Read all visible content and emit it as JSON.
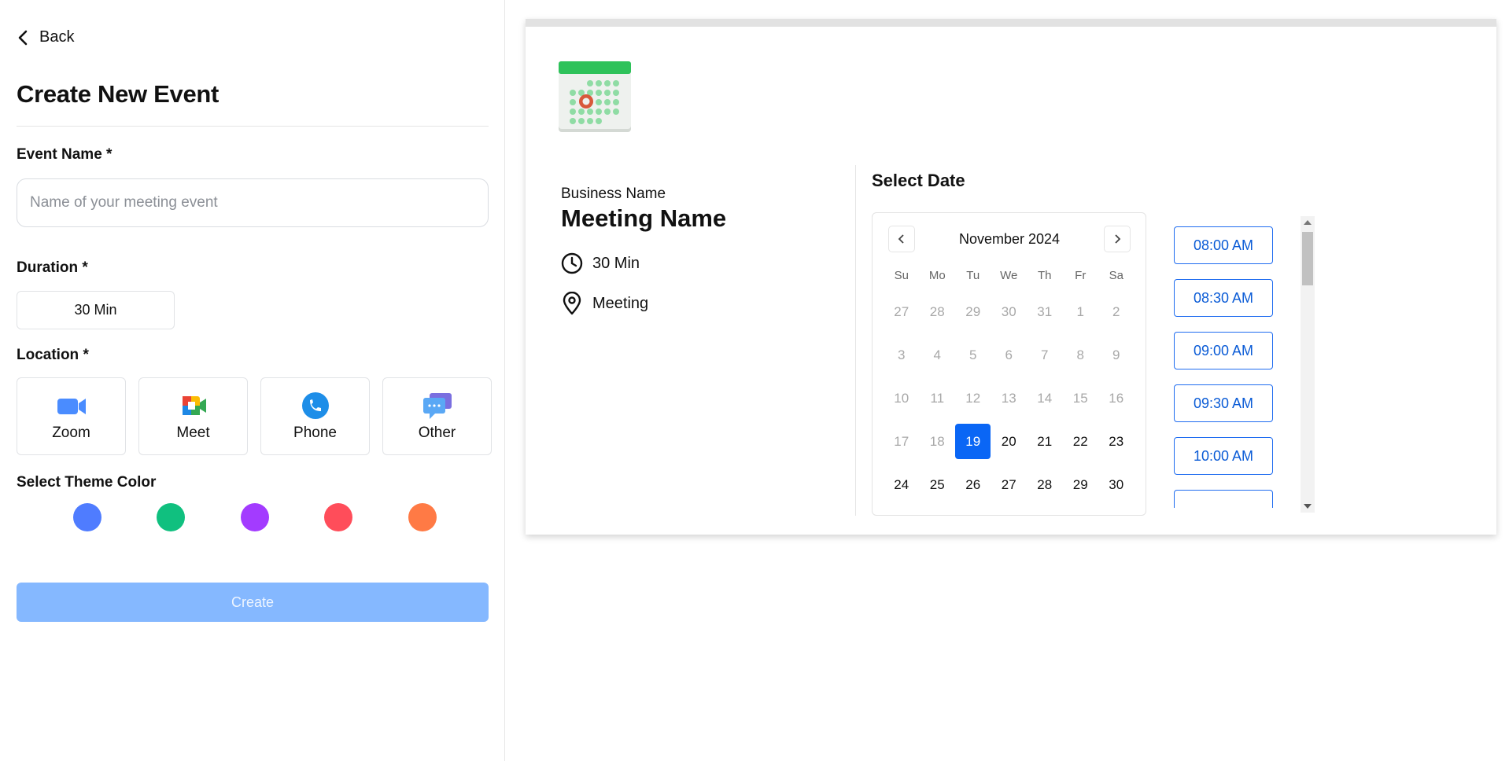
{
  "back_label": "Back",
  "form": {
    "title": "Create New Event",
    "event_name_label": "Event Name *",
    "event_name_placeholder": "Name of your meeting event",
    "event_name_value": "",
    "duration_label": "Duration *",
    "duration_value": "30 Min",
    "location_label": "Location *",
    "locations": [
      "Zoom",
      "Meet",
      "Phone",
      "Other"
    ],
    "theme_label": "Select Theme Color",
    "theme_colors": [
      "#4f7cff",
      "#10c07f",
      "#a33bff",
      "#ff4d5a",
      "#ff7a45"
    ],
    "create_label": "Create"
  },
  "preview": {
    "business_name": "Business Name",
    "meeting_name": "Meeting Name",
    "duration": "30 Min",
    "location": "Meeting",
    "select_date_label": "Select Date",
    "calendar": {
      "month_label": "November 2024",
      "weekdays": [
        "Su",
        "Mo",
        "Tu",
        "We",
        "Th",
        "Fr",
        "Sa"
      ],
      "weeks": [
        [
          "27",
          "28",
          "29",
          "30",
          "31",
          "1",
          "2"
        ],
        [
          "3",
          "4",
          "5",
          "6",
          "7",
          "8",
          "9"
        ],
        [
          "10",
          "11",
          "12",
          "13",
          "14",
          "15",
          "16"
        ],
        [
          "17",
          "18",
          "19",
          "20",
          "21",
          "22",
          "23"
        ],
        [
          "24",
          "25",
          "26",
          "27",
          "28",
          "29",
          "30"
        ]
      ],
      "selected_day": "19"
    },
    "time_slots": [
      "08:00 AM",
      "08:30 AM",
      "09:00 AM",
      "09:30 AM",
      "10:00 AM",
      ""
    ]
  },
  "colors": {
    "accent": "#0a66f5",
    "create_button": "#85b8ff"
  }
}
